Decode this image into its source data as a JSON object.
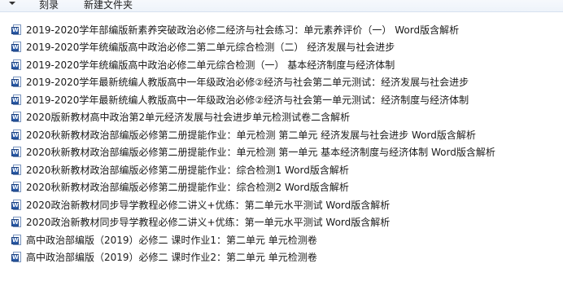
{
  "toolbar": {
    "burn_label": "刻录",
    "new_folder_label": "新建文件夹",
    "organize_dropdown": "chevron-down-icon"
  },
  "files": [
    {
      "name": "2019-2020学年部编版新素养突破政治必修二经济与社会练习：单元素养评价（一） Word版含解析",
      "icon": "word-document-icon"
    },
    {
      "name": "2019-2020学年统编版高中政治必修二第二单元综合检测（二）  经济发展与社会进步",
      "icon": "word-document-icon"
    },
    {
      "name": "2019-2020学年统编版高中政治必修二单元综合检测（一）  基本经济制度与经济体制",
      "icon": "word-document-icon"
    },
    {
      "name": "2019-2020学年最新统编人教版高中一年级政治必修②经济与社会第二单元测试：经济发展与社会进步",
      "icon": "word-document-icon"
    },
    {
      "name": "2019-2020学年最新统编人教版高中一年级政治必修②经济与社会第一单元测试：经济制度与经济体制",
      "icon": "word-document-icon"
    },
    {
      "name": "2020版新教材高中政治第2单元经济发展与社会进步单元检测试卷二含解析",
      "icon": "word-document-icon"
    },
    {
      "name": "2020秋新教材政治部编版必修第二册提能作业：单元检测 第二单元 经济发展与社会进步 Word版含解析",
      "icon": "word-document-icon"
    },
    {
      "name": "2020秋新教材政治部编版必修第二册提能作业：单元检测 第一单元 基本经济制度与经济体制 Word版含解析",
      "icon": "word-document-icon"
    },
    {
      "name": "2020秋新教材政治部编版必修第二册提能作业：综合检测1 Word版含解析",
      "icon": "word-document-icon"
    },
    {
      "name": "2020秋新教材政治部编版必修第二册提能作业：综合检测2 Word版含解析",
      "icon": "word-document-icon"
    },
    {
      "name": "2020政治新教材同步导学教程必修二讲义+优练：第二单元水平测试 Word版含解析",
      "icon": "word-document-icon"
    },
    {
      "name": "2020政治新教材同步导学教程必修二讲义+优练：第一单元水平测试 Word版含解析",
      "icon": "word-document-icon"
    },
    {
      "name": "高中政治部编版（2019）必修二 课时作业1：第二单元 单元检测卷",
      "icon": "word-document-icon"
    },
    {
      "name": "高中政治部编版（2019）必修二 课时作业2：第二单元 单元检测卷",
      "icon": "word-document-icon"
    }
  ]
}
